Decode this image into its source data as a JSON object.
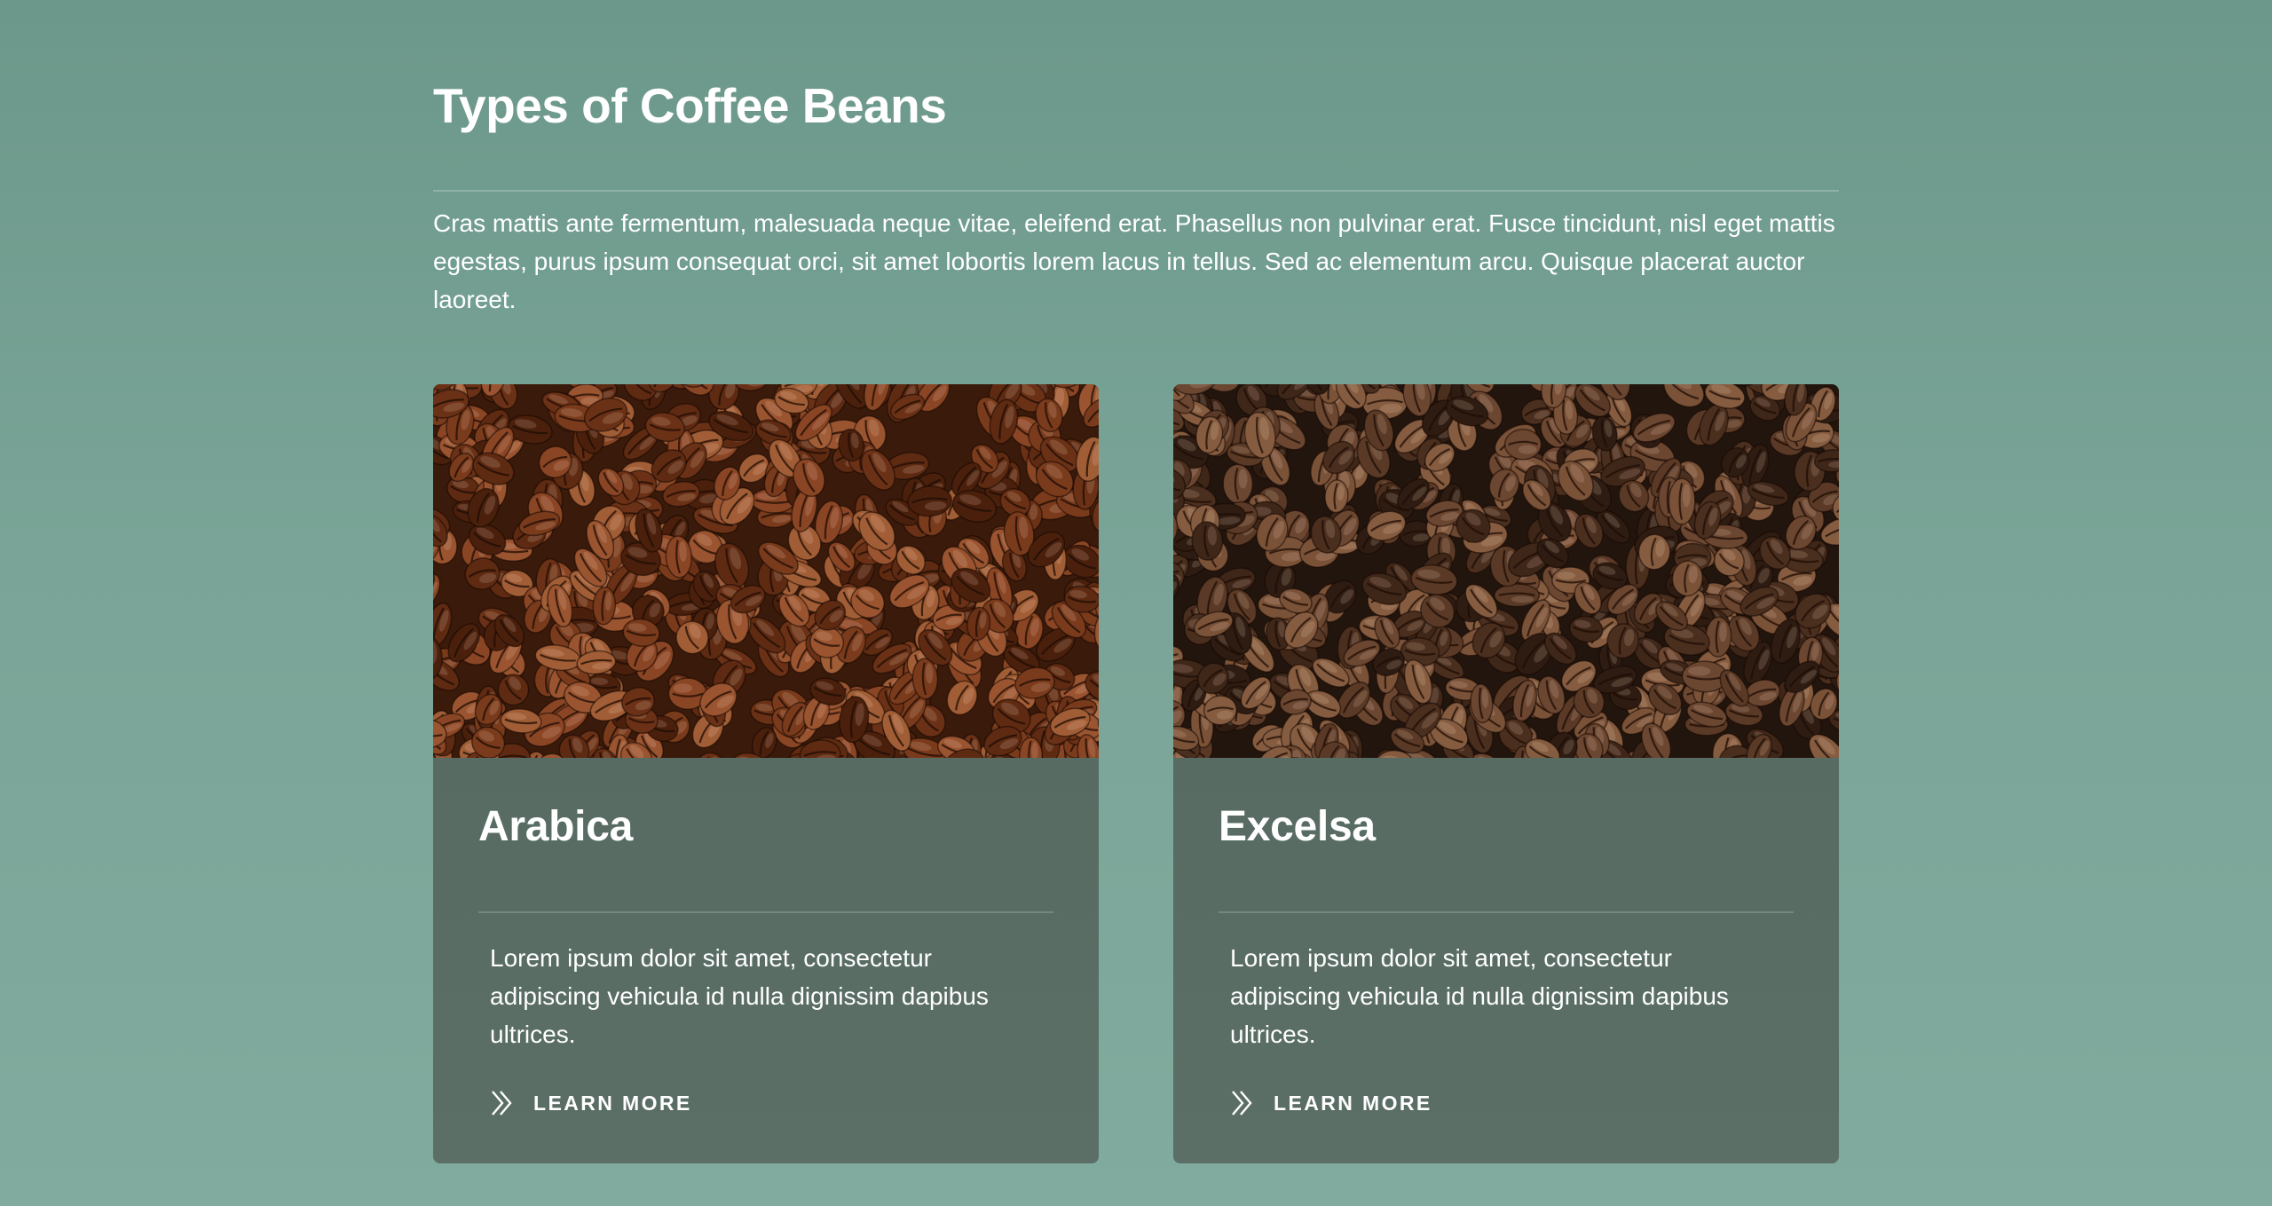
{
  "section": {
    "title": "Types of Coffee Beans",
    "intro": "Cras mattis ante fermentum, malesuada neque vitae, eleifend erat. Phasellus non pulvinar erat. Fusce tincidunt, nisl eget mattis egestas, purus ipsum consequat orci, sit amet lobortis lorem lacus in tellus. Sed ac elementum arcu. Quisque placerat auctor laoreet."
  },
  "cards": [
    {
      "title": "Arabica",
      "text": "Lorem ipsum dolor sit amet, consectetur adipiscing vehicula id nulla dignissim dapibus ultrices.",
      "link_label": "LEARN MORE",
      "link_icon": "double-chevron-right-icon"
    },
    {
      "title": "Excelsa",
      "text": "Lorem ipsum dolor sit amet, consectetur adipiscing vehicula id nulla dignissim dapibus ultrices.",
      "link_label": "LEARN MORE",
      "link_icon": "double-chevron-right-icon"
    }
  ],
  "colors": {
    "background": "#79a497",
    "card_body": "#5a6e66",
    "text": "#ffffff"
  }
}
